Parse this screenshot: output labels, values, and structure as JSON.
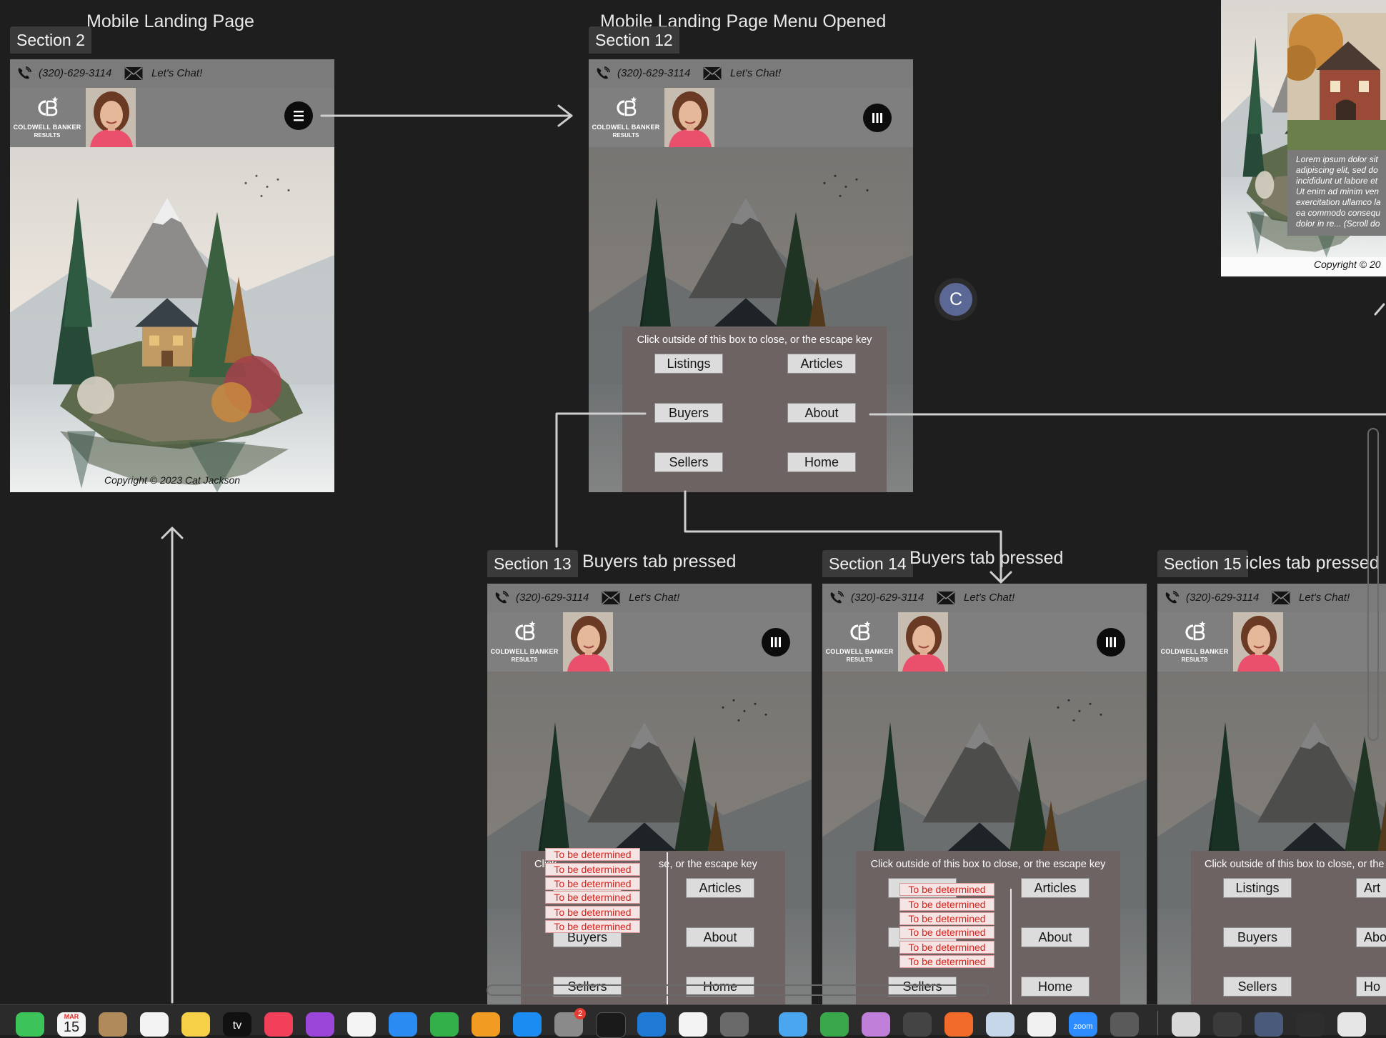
{
  "contact": {
    "phone": "(320)-629-3114",
    "chat": "Let's Chat!"
  },
  "brand": {
    "line1": "COLDWELL BANKER",
    "line2": "RESULTS"
  },
  "copyright": "Copyright © 2023 Cat Jackson",
  "menu": {
    "hint": "Click outside of this box to close, or the escape key",
    "hint_partial_13_left": "Click",
    "hint_partial_13_right": "se, or the escape key",
    "listings": "Listings",
    "articles": "Articles",
    "buyers": "Buyers",
    "about": "About",
    "sellers": "Sellers",
    "home": "Home",
    "about_partial": "Abo",
    "articles_partial": "Art",
    "home_partial": "Ho"
  },
  "tbd_label": "To be determined",
  "sections": {
    "s2": {
      "tag": "Section 2",
      "title": "Mobile Landing Page"
    },
    "s12": {
      "tag": "Section 12",
      "title": "Mobile Landing Page Menu Opened"
    },
    "s13": {
      "tag": "Section 13",
      "title": "Buyers tab pressed"
    },
    "s14": {
      "tag": "Section 14",
      "title": "Buyers tab pressed"
    },
    "s15": {
      "tag": "Section 15",
      "title": "icles tab pressed"
    }
  },
  "preview_panel": {
    "text_lines": [
      "Lorem ipsum dolor sit",
      "adipiscing elit, sed do",
      "incididunt ut labore et",
      "Ut enim ad minim ven",
      "exercitation ullamco la",
      "ea commodo consequ",
      "dolor in re... (Scroll do"
    ],
    "copyright": "Copyright © 20"
  },
  "collaborator": {
    "initial": "C"
  },
  "dock": {
    "calendar_month": "MAR",
    "calendar_day": "15",
    "settings_badge": "2",
    "tv_label": "tv",
    "zoom_label": "zoom"
  },
  "colors": {
    "canvas": "#1e1e1e",
    "frame": "#777777",
    "menu_panel": "#6d6363",
    "tbd_text": "#d4241c",
    "avatar": "#5b6795"
  }
}
